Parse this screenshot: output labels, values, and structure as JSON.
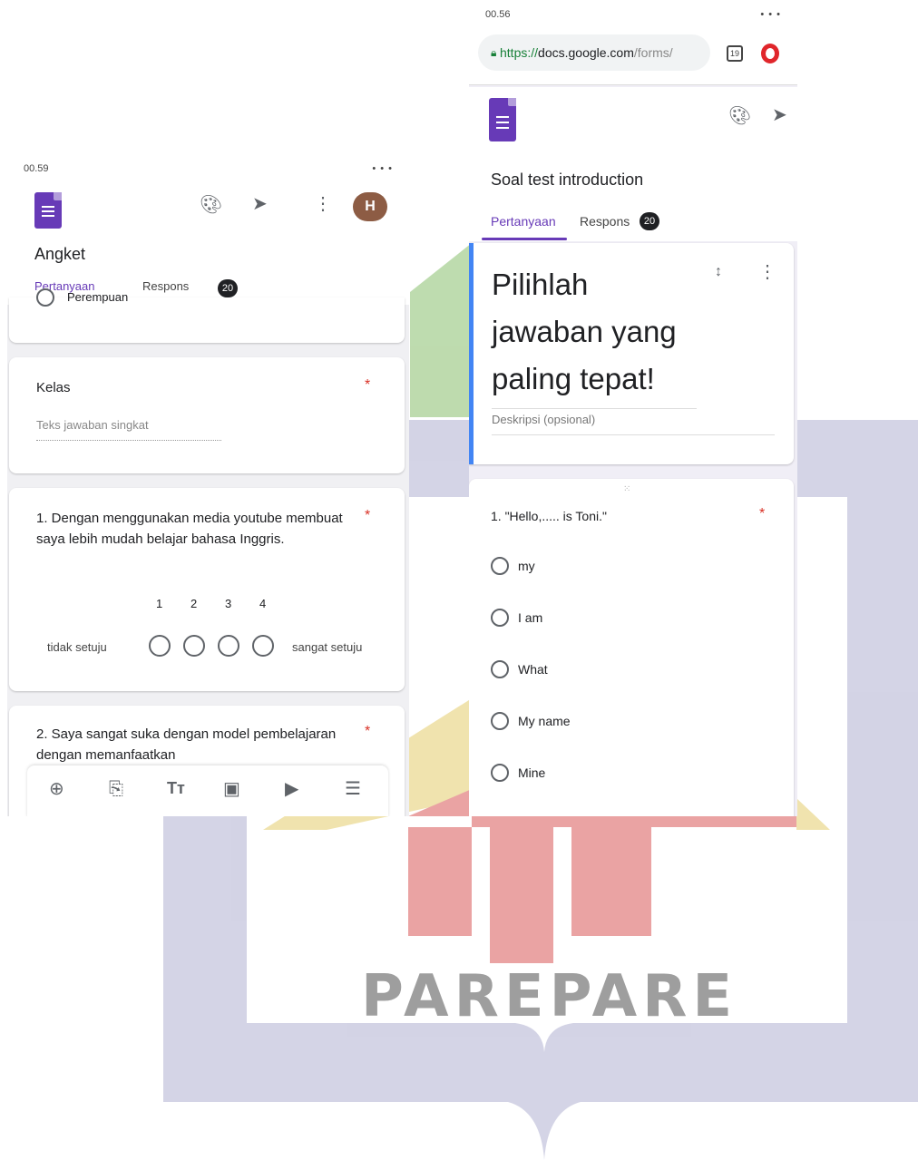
{
  "watermark": {
    "text": "PAREPARE"
  },
  "left_phone": {
    "status_time": "00.59",
    "status_icons": "• • • ",
    "form_title": "Angket",
    "tabs": {
      "questions": "Pertanyaan",
      "responses": "Respons",
      "response_count": "20"
    },
    "avatar_letter": "H",
    "partial_option": "Perempuan",
    "short_question": {
      "title": "Kelas",
      "placeholder": "Teks jawaban singkat",
      "required_mark": "*"
    },
    "scale_question": {
      "title": "1. Dengan menggunakan media youtube membuat saya lebih mudah belajar bahasa Inggris.",
      "required_mark": "*",
      "scale_numbers": [
        "1",
        "2",
        "3",
        "4"
      ],
      "low_label": "tidak setuju",
      "high_label": "sangat setuju"
    },
    "next_question": {
      "title": "2. Saya sangat suka dengan model pembelajaran dengan memanfaatkan",
      "required_mark": "*"
    },
    "toolbar_icons": [
      "add-question-icon",
      "import-question-icon",
      "title-text-icon",
      "image-icon",
      "video-icon",
      "section-icon"
    ]
  },
  "right_phone": {
    "status_time": "00.56",
    "url": "https://docs.google.com/forms/",
    "url_protocol": "https://",
    "url_host": "docs.google.com",
    "url_path": "/forms/",
    "tab_count": "19",
    "form_title": "Soal test introduction",
    "tabs": {
      "questions": "Pertanyaan",
      "responses": "Respons",
      "response_count": "20"
    },
    "header_card": {
      "title": "Pilihlah jawaban yang paling tepat!",
      "description_placeholder": "Deskripsi (opsional)"
    },
    "question": {
      "title": "1. \"Hello,..... is Toni.\"",
      "required_mark": "*",
      "options": [
        "my",
        "I am",
        "What",
        "My name",
        "Mine"
      ]
    }
  },
  "colors": {
    "accent": "#673ab7",
    "required": "#d93025",
    "watermark_lavender": "#cfcfe3",
    "watermark_green": "#b7d8a6",
    "watermark_yellow": "#efe0a6",
    "watermark_red": "#e89a9a"
  }
}
